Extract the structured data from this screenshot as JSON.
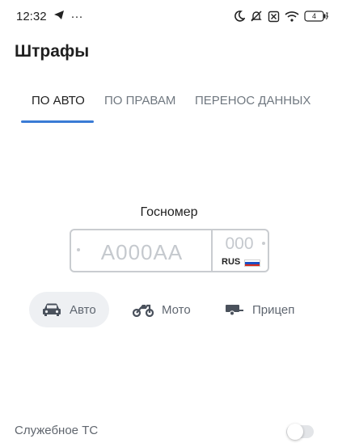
{
  "status_bar": {
    "time": "12:32",
    "more": "···",
    "battery": "4"
  },
  "page": {
    "title": "Штрафы"
  },
  "tabs": [
    {
      "label": "ПО АВТО",
      "active": true
    },
    {
      "label": "ПО ПРАВАМ",
      "active": false
    },
    {
      "label": "ПЕРЕНОС ДАННЫХ",
      "active": false
    }
  ],
  "plate": {
    "title": "Госномер",
    "number_placeholder": "A000AA",
    "region_placeholder": "000",
    "country": "RUS"
  },
  "vehicle_types": [
    {
      "label": "Авто",
      "icon": "car-icon",
      "active": true
    },
    {
      "label": "Мото",
      "icon": "motorcycle-icon",
      "active": false
    },
    {
      "label": "Прицеп",
      "icon": "trailer-icon",
      "active": false
    }
  ],
  "service_vehicle": {
    "label": "Служебное ТС",
    "enabled": false
  },
  "colors": {
    "accent": "#3a7bd5",
    "text_primary": "#1f1f1f",
    "text_secondary": "#707880",
    "chip_background": "#eef0f3"
  }
}
